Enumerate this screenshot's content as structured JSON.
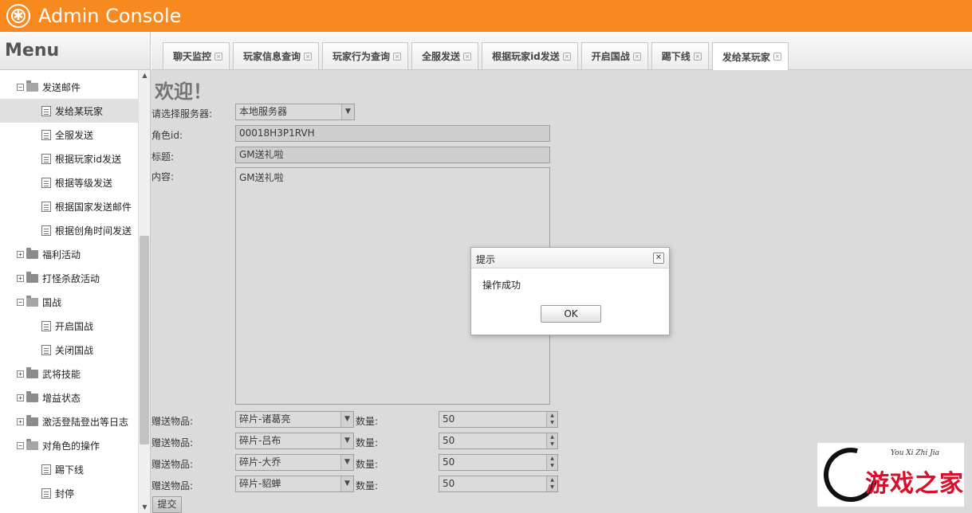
{
  "header": {
    "title": "Admin Console"
  },
  "sidebar": {
    "title": "Menu",
    "items": [
      {
        "label": "发送邮件",
        "level": 1,
        "expanded": true,
        "type": "folder"
      },
      {
        "label": "发给某玩家",
        "level": 2,
        "type": "file",
        "selected": true
      },
      {
        "label": "全服发送",
        "level": 2,
        "type": "file"
      },
      {
        "label": "根据玩家id发送",
        "level": 2,
        "type": "file"
      },
      {
        "label": "根据等级发送",
        "level": 2,
        "type": "file"
      },
      {
        "label": "根据国家发送邮件",
        "level": 2,
        "type": "file"
      },
      {
        "label": "根据创角时间发送",
        "level": 2,
        "type": "file"
      },
      {
        "label": "福利活动",
        "level": 1,
        "expanded": false,
        "type": "folder"
      },
      {
        "label": "打怪杀敌活动",
        "level": 1,
        "expanded": false,
        "type": "folder"
      },
      {
        "label": "国战",
        "level": 1,
        "expanded": true,
        "type": "folder"
      },
      {
        "label": "开启国战",
        "level": 2,
        "type": "file"
      },
      {
        "label": "关闭国战",
        "level": 2,
        "type": "file"
      },
      {
        "label": "武将技能",
        "level": 1,
        "expanded": false,
        "type": "folder"
      },
      {
        "label": "增益状态",
        "level": 1,
        "expanded": false,
        "type": "folder"
      },
      {
        "label": "激活登陆登出等日志",
        "level": 1,
        "expanded": false,
        "type": "folder"
      },
      {
        "label": "对角色的操作",
        "level": 1,
        "expanded": true,
        "type": "folder"
      },
      {
        "label": "踢下线",
        "level": 2,
        "type": "file"
      },
      {
        "label": "封停",
        "level": 2,
        "type": "file"
      }
    ]
  },
  "tabs": [
    {
      "label": "聊天监控"
    },
    {
      "label": "玩家信息查询"
    },
    {
      "label": "玩家行为查询"
    },
    {
      "label": "全服发送"
    },
    {
      "label": "根据玩家id发送"
    },
    {
      "label": "开启国战"
    },
    {
      "label": "踢下线"
    },
    {
      "label": "发给某玩家",
      "active": true
    }
  ],
  "main": {
    "welcome": "欢迎！",
    "server_label": "请选择服务器:",
    "server_value": "本地服务器",
    "role_id_label": "角色id:",
    "role_id_value": "00018H3P1RVH",
    "title_label": "标题:",
    "title_value": "GM送礼啦",
    "content_label": "内容:",
    "content_value": "GM送礼啦",
    "gifts": [
      {
        "label": "赠送物品:",
        "item": "碎片-诸葛亮",
        "qty_label": "数量:",
        "qty": "50"
      },
      {
        "label": "赠送物品:",
        "item": "碎片-吕布",
        "qty_label": "数量:",
        "qty": "50"
      },
      {
        "label": "赠送物品:",
        "item": "碎片-大乔",
        "qty_label": "数量:",
        "qty": "50"
      },
      {
        "label": "赠送物品:",
        "item": "碎片-貂蝉",
        "qty_label": "数量:",
        "qty": "50"
      }
    ],
    "submit_label": "提交"
  },
  "dialog": {
    "title": "提示",
    "message": "操作成功",
    "ok_label": "OK"
  },
  "watermark": {
    "small_text": "You Xi Zhi Jia",
    "text": "游戏之家"
  },
  "colors": {
    "header_bg": "#f7891f",
    "watermark_text": "#d8102c"
  }
}
